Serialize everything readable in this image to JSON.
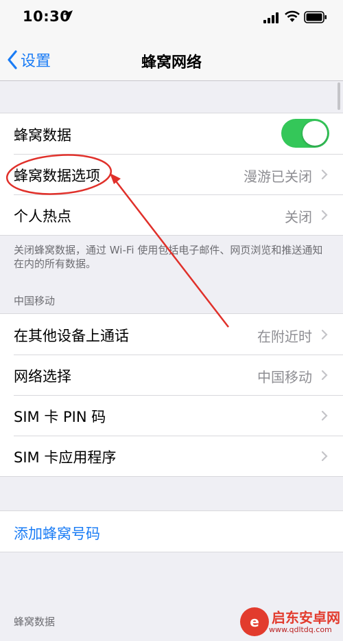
{
  "status_bar": {
    "time": "10:30"
  },
  "nav": {
    "back_label": "设置",
    "title": "蜂窝网络"
  },
  "section1": {
    "rows": [
      {
        "label": "蜂窝数据",
        "toggle_on": true
      },
      {
        "label": "蜂窝数据选项",
        "value": "漫游已关闭"
      },
      {
        "label": "个人热点",
        "value": "关闭"
      }
    ],
    "footer": "关闭蜂窝数据，通过 Wi-Fi 使用包括电子邮件、网页浏览和推送通知在内的所有数据。"
  },
  "section2": {
    "header": "中国移动",
    "rows": [
      {
        "label": "在其他设备上通话",
        "value": "在附近时"
      },
      {
        "label": "网络选择",
        "value": "中国移动"
      },
      {
        "label": "SIM 卡 PIN 码",
        "value": ""
      },
      {
        "label": "SIM 卡应用程序",
        "value": ""
      }
    ]
  },
  "section3": {
    "add_label": "添加蜂窝号码"
  },
  "section4": {
    "header": "蜂窝数据"
  },
  "annotation": {
    "color": "#e0302a"
  },
  "watermark": {
    "text": "启东安卓网",
    "url": "www.qdltdq.com"
  }
}
